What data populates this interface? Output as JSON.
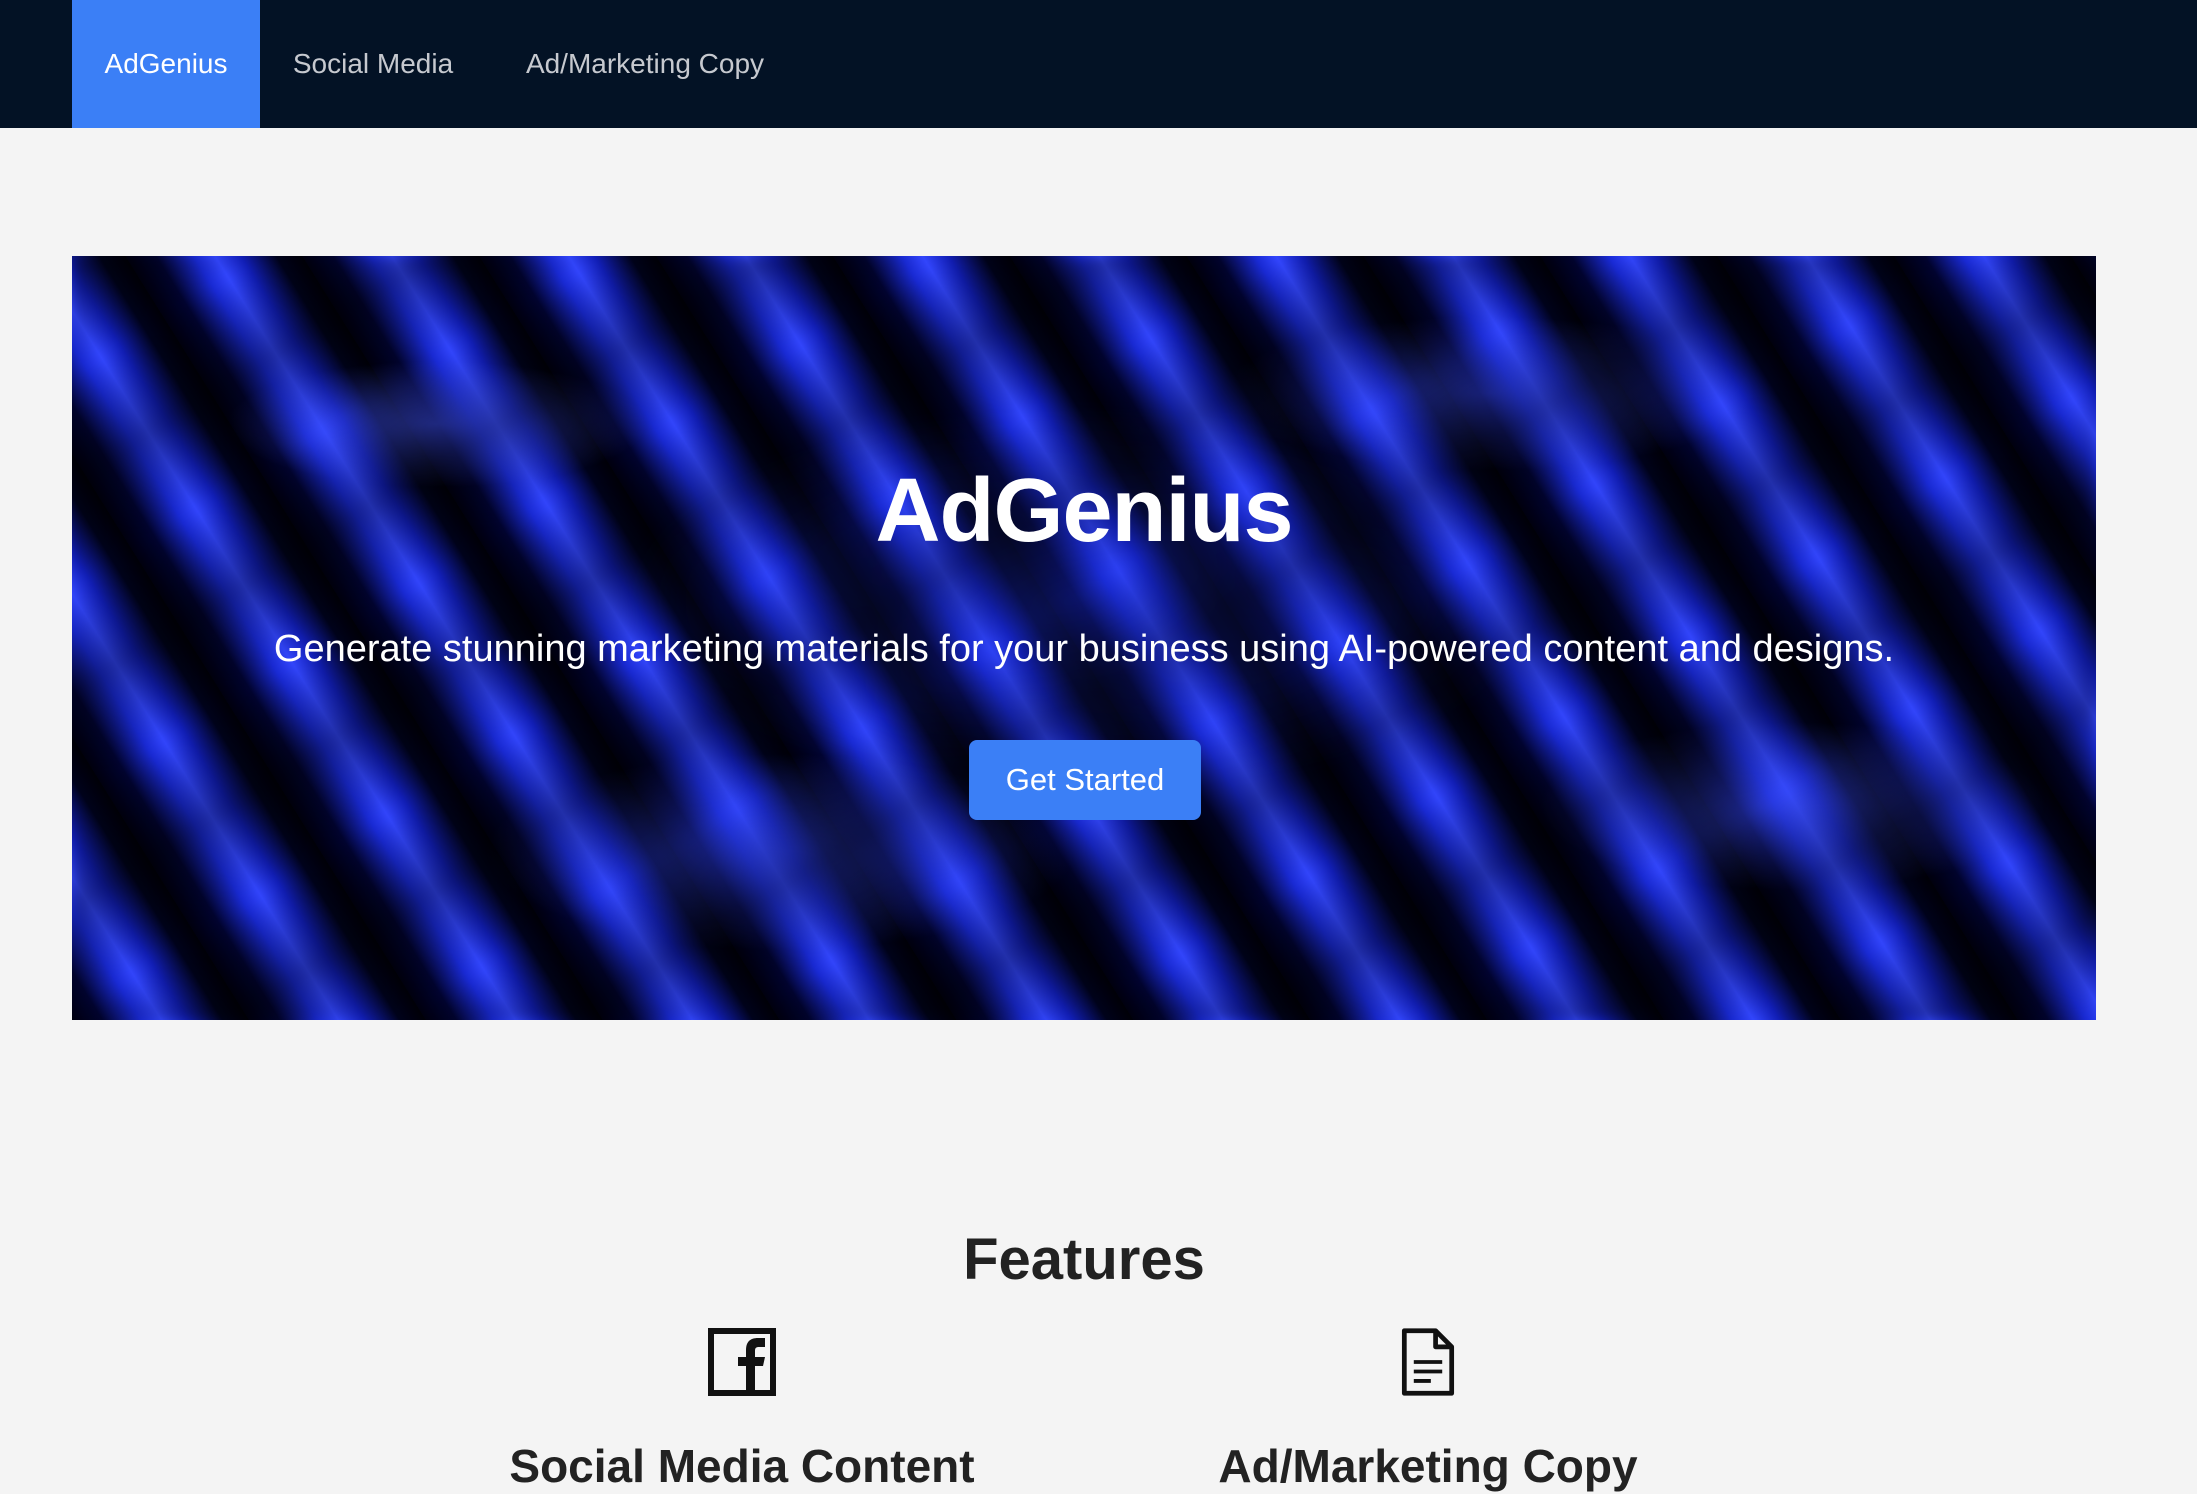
{
  "navbar": {
    "brand": "AdGenius",
    "items": [
      {
        "label": "Social Media"
      },
      {
        "label": "Ad/Marketing Copy"
      }
    ]
  },
  "hero": {
    "title": "AdGenius",
    "subtitle": "Generate stunning marketing materials for your business using AI-powered content and designs.",
    "cta_label": "Get Started"
  },
  "features": {
    "title": "Features",
    "items": [
      {
        "icon": "facebook-icon",
        "title": "Social Media Content"
      },
      {
        "icon": "document-icon",
        "title": "Ad/Marketing Copy"
      }
    ]
  },
  "colors": {
    "navbar_bg": "#031225",
    "accent": "#3b7ff6",
    "page_bg": "#f4f4f4",
    "heading_text": "#222222"
  }
}
